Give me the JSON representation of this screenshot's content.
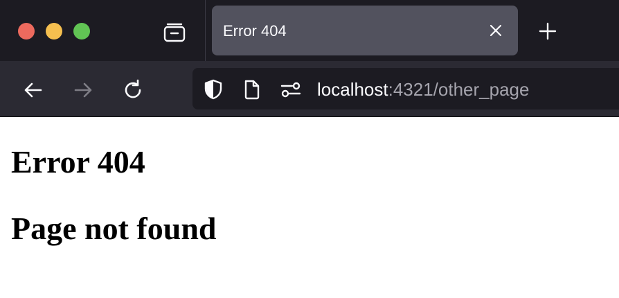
{
  "tab": {
    "title": "Error 404"
  },
  "urlbar": {
    "host": "localhost",
    "rest": ":4321/other_page"
  },
  "page": {
    "heading": "Error 404",
    "subheading": "Page not found"
  },
  "icons": {
    "window_close": "close-circle",
    "window_minimize": "minimize-circle",
    "window_maximize": "maximize-circle",
    "tab_tray": "tab-tray-icon",
    "tab_close": "close-icon",
    "new_tab": "plus-icon",
    "back": "back-arrow-icon",
    "forward": "forward-arrow-icon",
    "reload": "reload-icon",
    "shield": "shield-icon",
    "page": "page-icon",
    "permissions": "permissions-icon"
  },
  "colors": {
    "tabstrip_bg": "#1c1b22",
    "navbar_bg": "#2b2a33",
    "active_tab_bg": "#52525e",
    "close_red": "#ed6a5e",
    "minimize_yellow": "#f5bf4f",
    "maximize_green": "#61c454"
  }
}
